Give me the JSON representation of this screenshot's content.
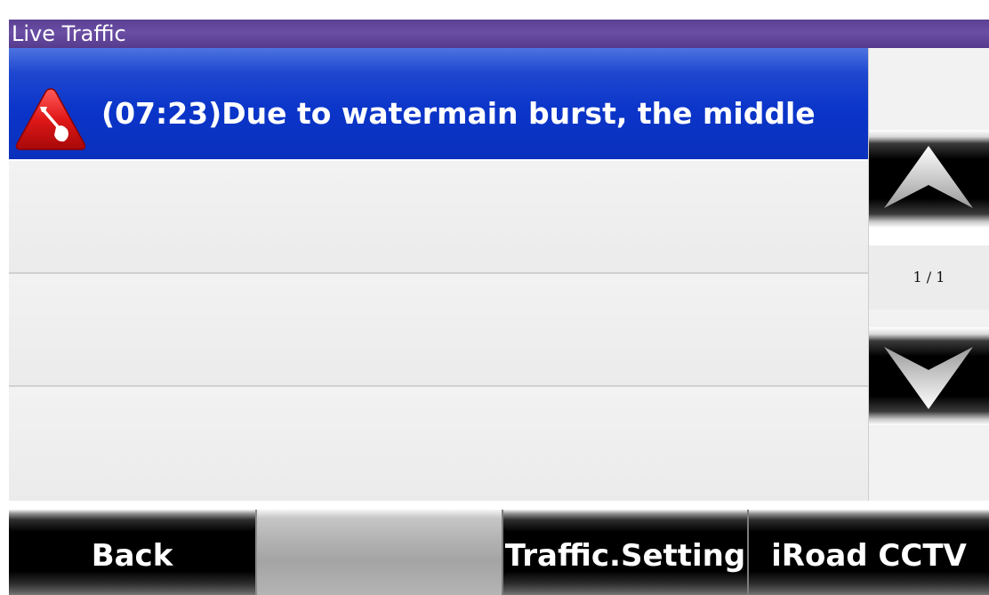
{
  "window": {
    "title": "Live Traffic"
  },
  "traffic_list": {
    "items": [
      {
        "icon": "roadwork-warning-icon",
        "text": "(07:23)Due to watermain burst, the middle",
        "selected": true
      },
      {
        "text": "",
        "selected": false
      },
      {
        "text": "",
        "selected": false
      },
      {
        "text": "",
        "selected": false
      }
    ]
  },
  "pager": {
    "indicator": "1 / 1",
    "up_icon": "chevron-up-icon",
    "down_icon": "chevron-down-icon"
  },
  "bottom_bar": {
    "back_label": "Back",
    "blank_label": "",
    "traffic_setting_label": "Traffic.Setting",
    "iroad_cctv_label": "iRoad CCTV"
  },
  "colors": {
    "title_bar": "#5b4094",
    "selected_row": "#0b35c9",
    "warning_icon": "#d81f1f"
  }
}
